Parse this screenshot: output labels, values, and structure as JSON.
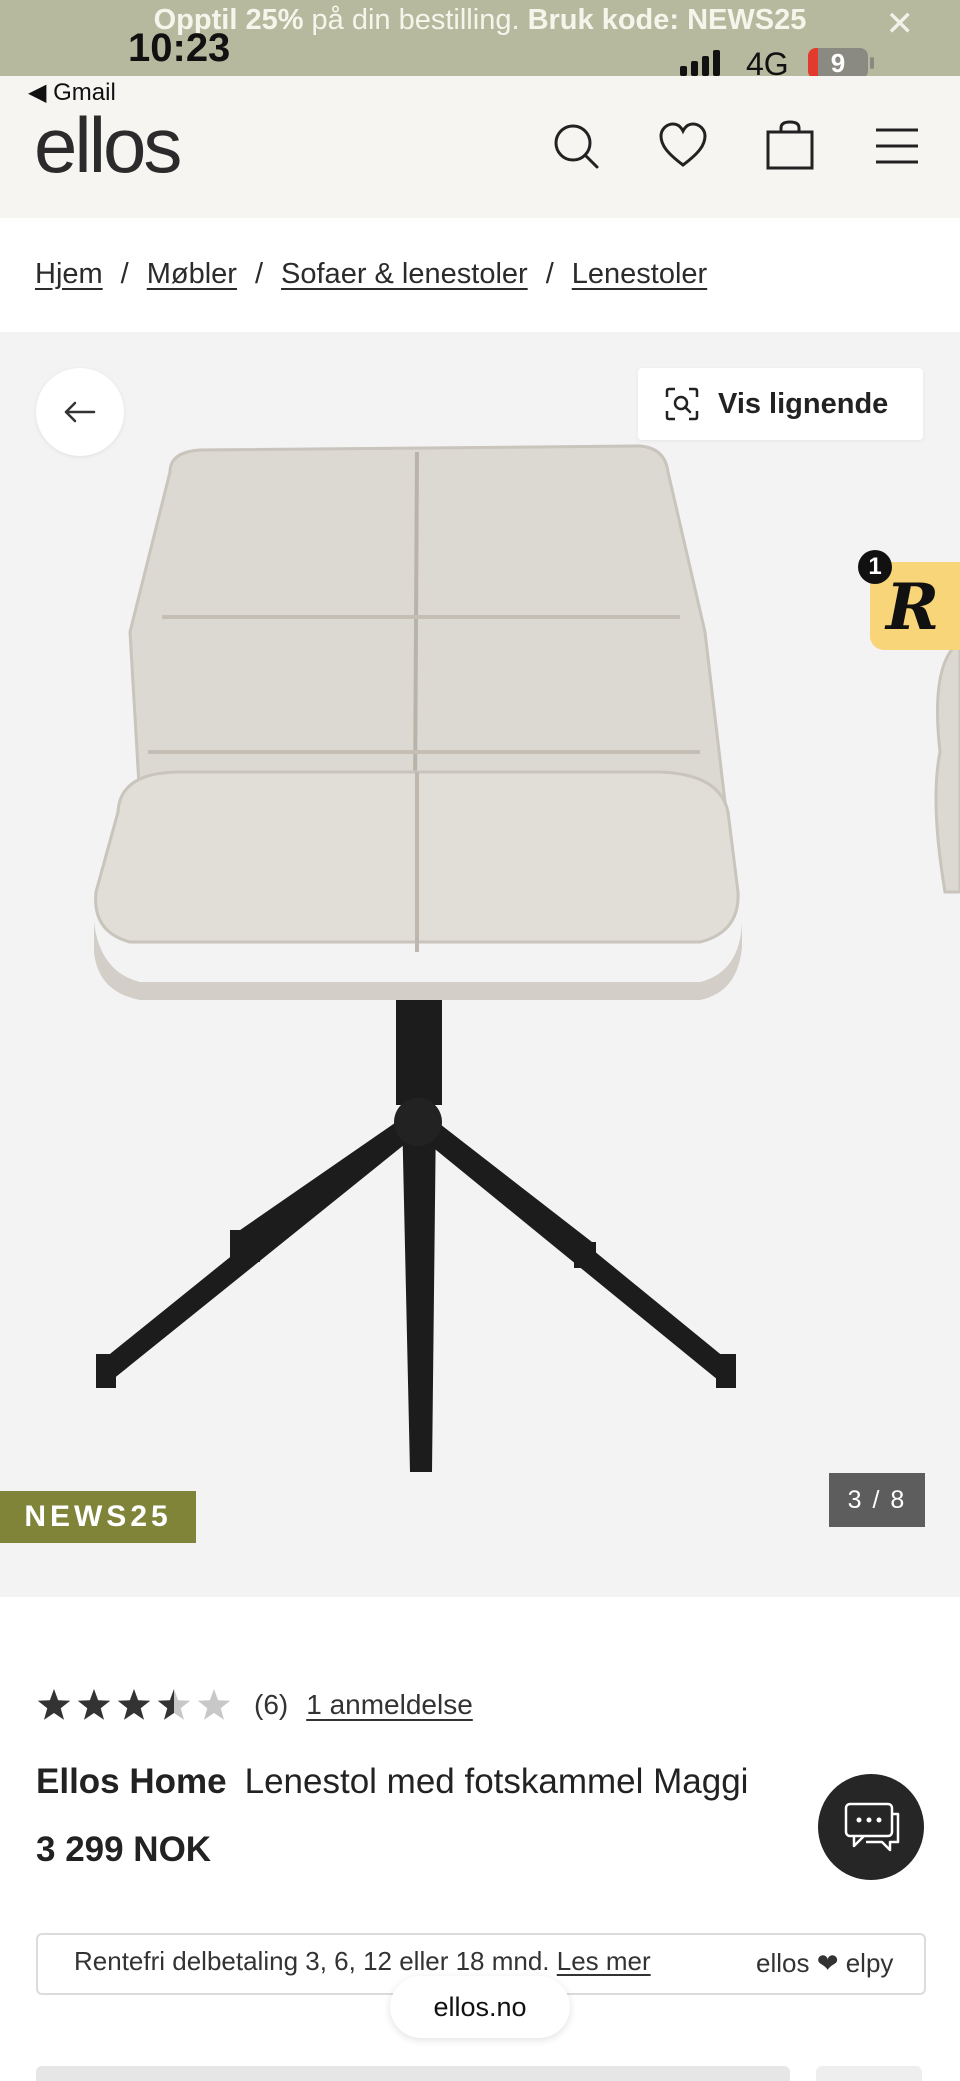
{
  "promo": {
    "text_before": "Opptil 25%",
    "text_middle": " på din bestilling. ",
    "text_code": "Bruk kode: NEWS25",
    "close_icon": "close-icon"
  },
  "status_bar": {
    "time": "10:23",
    "network": "4G",
    "battery": "9"
  },
  "header": {
    "back_app": "◀ Gmail",
    "logo": "ellos",
    "icons": [
      "search-icon",
      "heart-icon",
      "bag-icon",
      "menu-icon"
    ]
  },
  "breadcrumb": [
    "Hjem",
    "Møbler",
    "Sofaer & lenestoler",
    "Lenestoler"
  ],
  "breadcrumb_separator": "/",
  "gallery": {
    "similar_button": "Vis lignende",
    "r_badge_count": "1",
    "r_badge_letter": "R",
    "promo_tag": "NEWS25",
    "counter": "3 / 8"
  },
  "product": {
    "rating": 3.5,
    "rating_count": "(6)",
    "reviews_link": "1 anmeldelse",
    "brand": "Ellos Home",
    "name": "Lenestol med fotskammel Maggi",
    "price": "3 299 NOK"
  },
  "finance": {
    "text": "Rentefri delbetaling 3, 6, 12 eller 18 mnd. ",
    "link": "Les mer",
    "brand": "ellos ❤ elpy"
  },
  "browser": {
    "url": "ellos.no"
  }
}
